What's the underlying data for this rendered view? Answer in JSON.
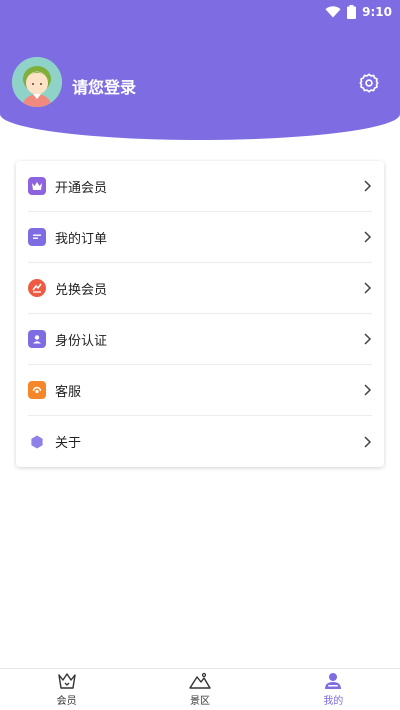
{
  "status": {
    "time": "9:10"
  },
  "profile": {
    "login_text": "请您登录"
  },
  "menu": [
    {
      "label": "开通会员",
      "icon": "crown-icon",
      "color": "#8d63e0"
    },
    {
      "label": "我的订单",
      "icon": "order-icon",
      "color": "#7e6de2"
    },
    {
      "label": "兑换会员",
      "icon": "exchange-icon",
      "color": "#ee5b45"
    },
    {
      "label": "身份认证",
      "icon": "id-icon",
      "color": "#7e6de2"
    },
    {
      "label": "客服",
      "icon": "service-icon",
      "color": "#f5862a"
    },
    {
      "label": "关于",
      "icon": "about-icon",
      "color": "#8d80e8"
    }
  ],
  "nav": [
    {
      "label": "会员",
      "icon": "crown-outline-icon",
      "active": false
    },
    {
      "label": "景区",
      "icon": "mountain-icon",
      "active": false
    },
    {
      "label": "我的",
      "icon": "person-icon",
      "active": true
    }
  ],
  "colors": {
    "primary": "#7e6de2"
  }
}
